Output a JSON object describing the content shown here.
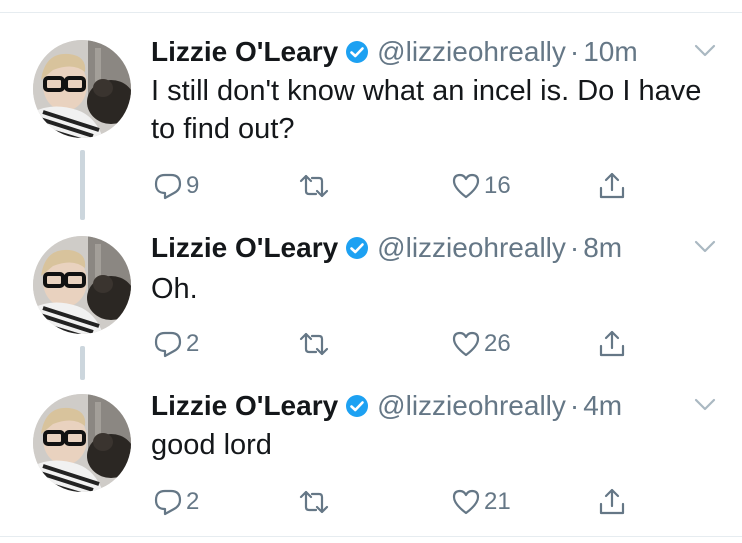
{
  "tweets": [
    {
      "name": "Lizzie O'Leary",
      "handle": "@lizzieohreally",
      "separator": "·",
      "time": "10m",
      "text": "I still don't know what an incel is. Do I have to find out?",
      "replies": "9",
      "retweets": "",
      "likes": "16"
    },
    {
      "name": "Lizzie O'Leary",
      "handle": "@lizzieohreally",
      "separator": "·",
      "time": "8m",
      "text": "Oh.",
      "replies": "2",
      "retweets": "",
      "likes": "26"
    },
    {
      "name": "Lizzie O'Leary",
      "handle": "@lizzieohreally",
      "separator": "·",
      "time": "4m",
      "text": "good lord",
      "replies": "2",
      "retweets": "",
      "likes": "21"
    }
  ],
  "icons": {
    "verified": "verified-badge-icon",
    "menu": "chevron-down-icon",
    "reply": "reply-icon",
    "retweet": "retweet-icon",
    "like": "heart-icon",
    "share": "share-icon"
  },
  "colors": {
    "verified_blue": "#1da1f2",
    "secondary_text": "#657786",
    "primary_text": "#14171a",
    "thread_line": "#ccd6dd"
  }
}
